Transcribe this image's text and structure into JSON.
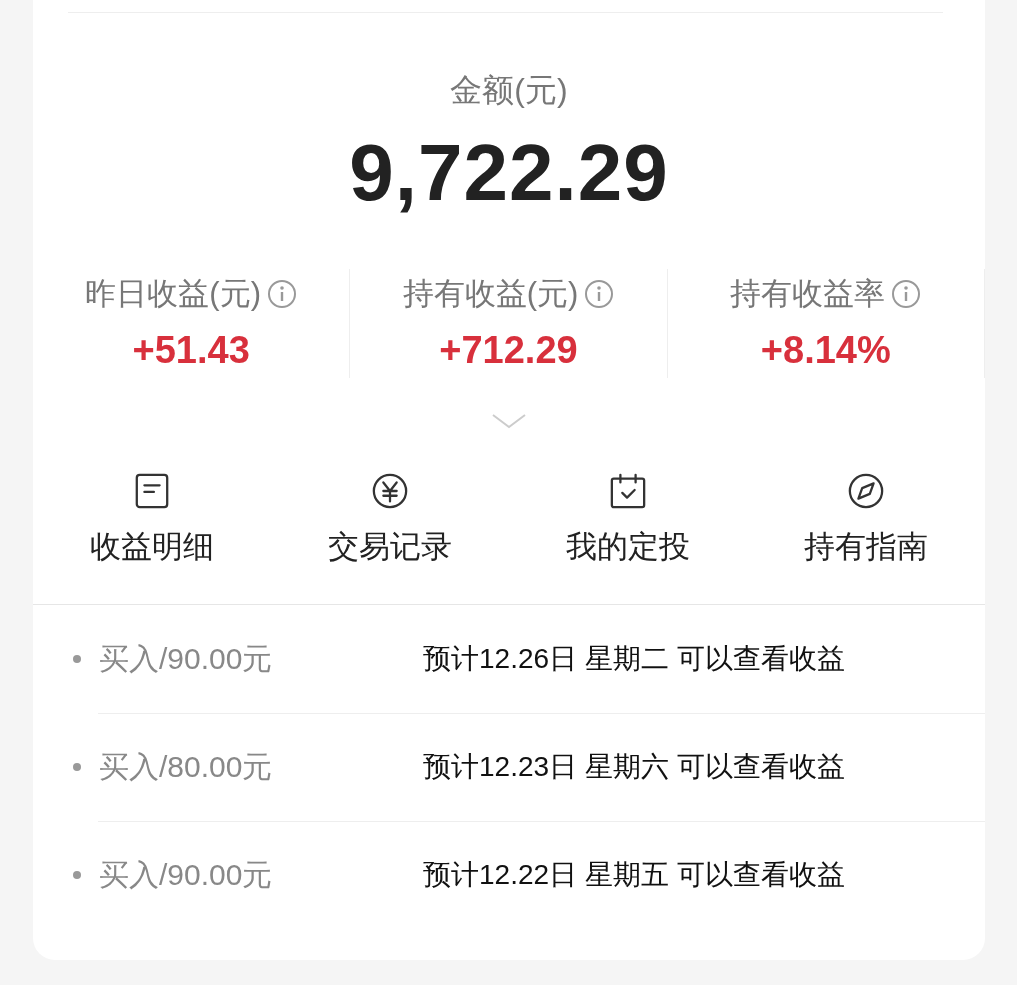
{
  "summary": {
    "label": "金额(元)",
    "amount": "9,722.29"
  },
  "stats": [
    {
      "label": "昨日收益(元)",
      "value": "+51.43"
    },
    {
      "label": "持有收益(元)",
      "value": "+712.29"
    },
    {
      "label": "持有收益率",
      "value": "+8.14%"
    }
  ],
  "actions": [
    {
      "kind": "document",
      "label": "收益明细"
    },
    {
      "kind": "yen",
      "label": "交易记录"
    },
    {
      "kind": "calendar",
      "label": "我的定投"
    },
    {
      "kind": "compass",
      "label": "持有指南"
    }
  ],
  "transactions": [
    {
      "label": "买入/90.00元",
      "note": "预计12.26日 星期二 可以查看收益"
    },
    {
      "label": "买入/80.00元",
      "note": "预计12.23日 星期六 可以查看收益"
    },
    {
      "label": "买入/90.00元",
      "note": "预计12.22日 星期五 可以查看收益"
    }
  ]
}
